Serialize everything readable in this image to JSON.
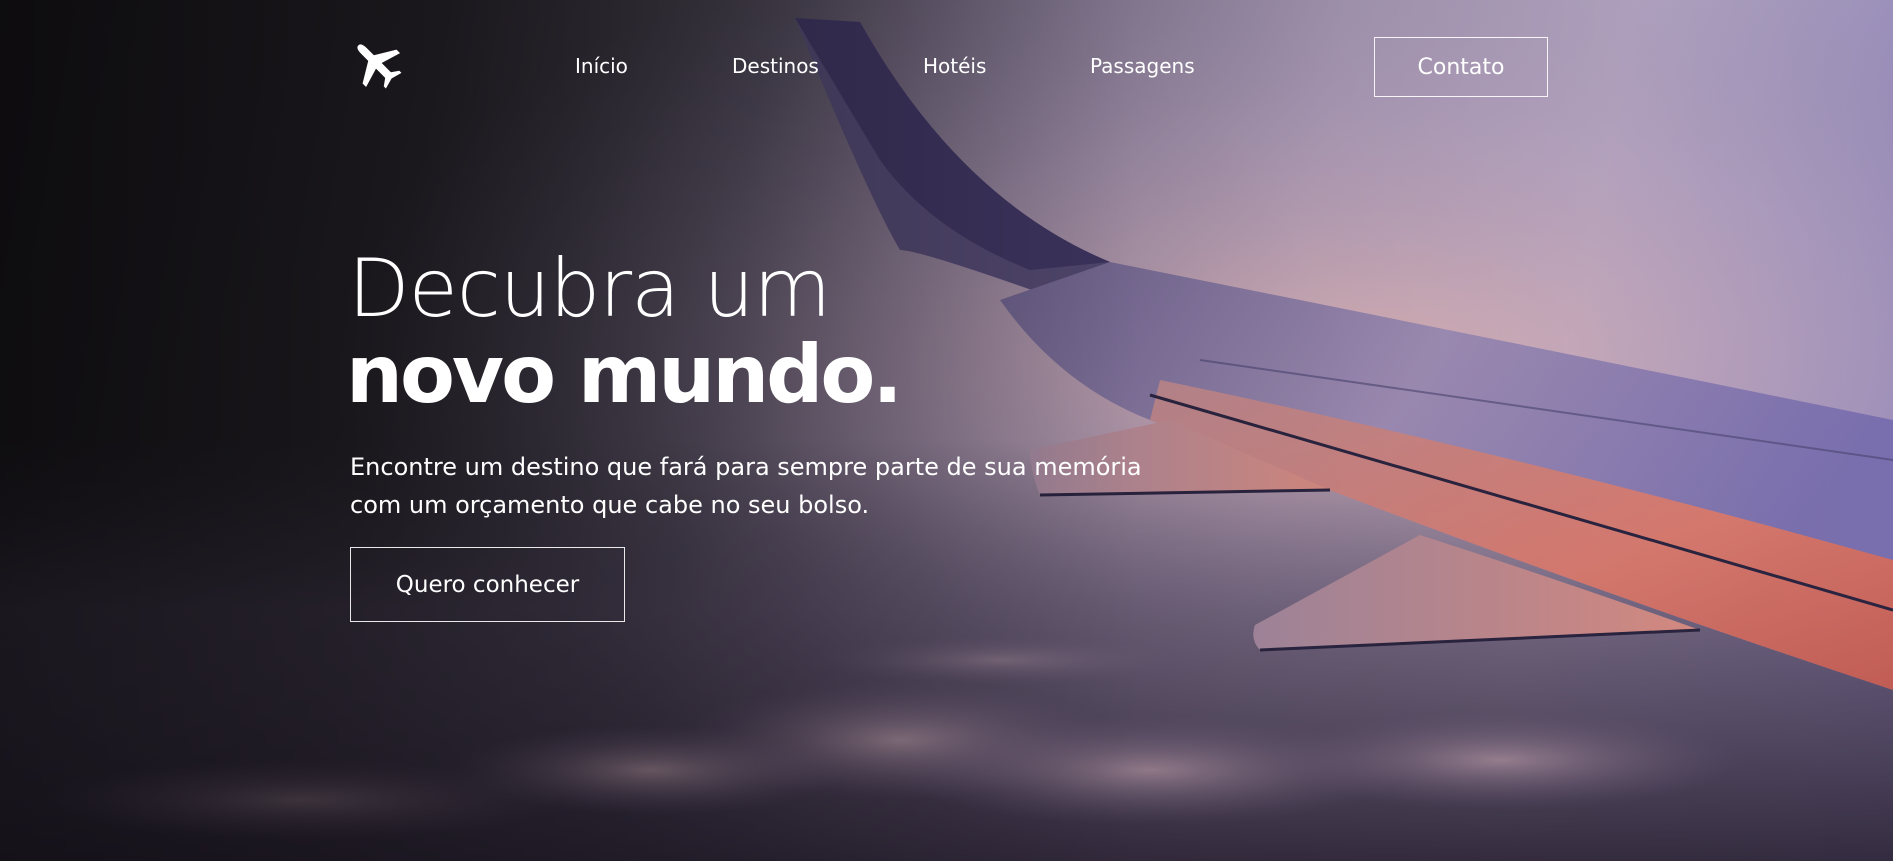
{
  "header": {
    "logo_icon": "airplane-icon",
    "nav_links": [
      "Início",
      "Destinos",
      "Hotéis",
      "Passagens"
    ],
    "contact_label": "Contato"
  },
  "hero": {
    "title_light": "Decubra um",
    "title_bold": "novo mundo.",
    "lead_line1": "Encontre um destino que fará para sempre parte de sua memória",
    "lead_line2": "com um orçamento que cabe no seu bolso.",
    "cta_label": "Quero conhecer",
    "background_image": "airplane-wing-above-clouds-at-sunset"
  },
  "colors": {
    "text": "#ffffff",
    "sky_dark": "#1d1a20",
    "sky_purple": "#8f86b8",
    "wing_glow": "#e07a68"
  }
}
